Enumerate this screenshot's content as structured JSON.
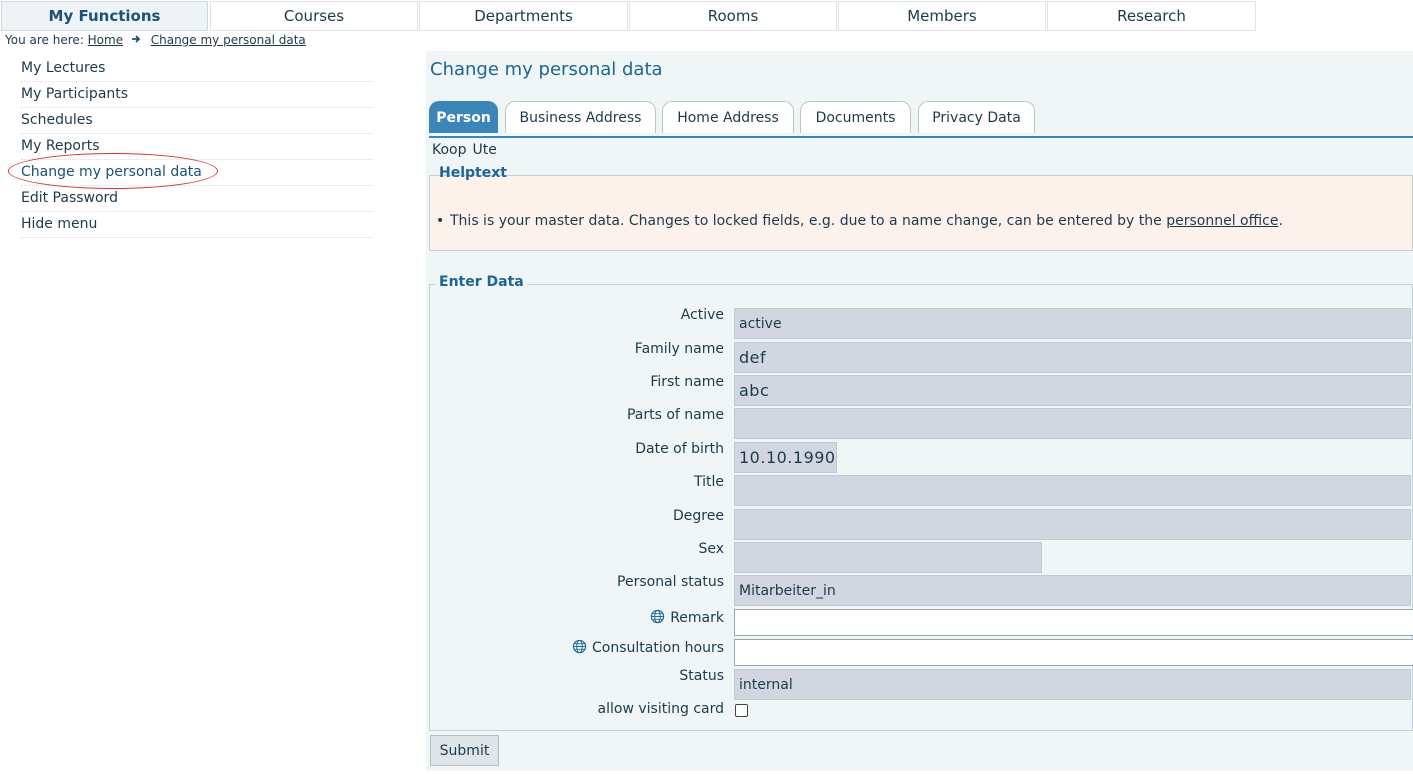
{
  "topnav": {
    "items": [
      {
        "label": "My Functions"
      },
      {
        "label": "Courses"
      },
      {
        "label": "Departments"
      },
      {
        "label": "Rooms"
      },
      {
        "label": "Members"
      },
      {
        "label": "Research"
      }
    ],
    "active_index": 0
  },
  "breadcrumb": {
    "prefix": "You are here:",
    "home": "Home",
    "current": "Change my personal data"
  },
  "sidebar": {
    "items": [
      {
        "label": "My Lectures"
      },
      {
        "label": "My Participants"
      },
      {
        "label": "Schedules"
      },
      {
        "label": "My Reports"
      },
      {
        "label": "Change my personal data"
      },
      {
        "label": "Edit Password"
      },
      {
        "label": "Hide menu"
      }
    ],
    "active_index": 4
  },
  "main": {
    "title": "Change my personal data",
    "tabs": [
      {
        "label": "Person"
      },
      {
        "label": "Business Address"
      },
      {
        "label": "Home Address"
      },
      {
        "label": "Documents"
      },
      {
        "label": "Privacy Data"
      }
    ],
    "active_tab": 0,
    "person": {
      "last_name": "Koop",
      "first_name": "Ute"
    },
    "helptext": {
      "legend": "Helptext",
      "text_before": "This is your master data. Changes to locked fields, e.g. due to a name change, can be entered by the ",
      "link": "personnel office",
      "text_after": "."
    },
    "form": {
      "legend": "Enter Data",
      "fields": {
        "active": {
          "label": "Active",
          "value": "active"
        },
        "family_name": {
          "label": "Family name",
          "value": "def"
        },
        "first_name": {
          "label": "First name",
          "value": "abc"
        },
        "parts_of_name": {
          "label": "Parts of name",
          "value": ""
        },
        "date_of_birth": {
          "label": "Date of birth",
          "value": "10.10.1990"
        },
        "title": {
          "label": "Title",
          "value": ""
        },
        "degree": {
          "label": "Degree",
          "value": ""
        },
        "sex": {
          "label": "Sex",
          "value": ""
        },
        "personal_status": {
          "label": "Personal status",
          "value": "Mitarbeiter_in"
        },
        "remark": {
          "label": "Remark",
          "value": ""
        },
        "consultation_hours": {
          "label": "Consultation hours",
          "value": ""
        },
        "status": {
          "label": "Status",
          "value": "internal"
        },
        "allow_visiting_card": {
          "label": "allow visiting card",
          "checked": false
        }
      },
      "submit_label": "Submit"
    }
  },
  "colors": {
    "accent": "#3a86b8",
    "title": "#1a6699",
    "help_bg": "#fdf1ec",
    "locked_field_bg": "#d1d6e0",
    "panel_bg": "#f0f5f5",
    "highlight_ellipse": "#dd3333"
  },
  "icons": {
    "breadcrumb_arrow": "arrow-right-icon",
    "translation": "globe-icon"
  }
}
